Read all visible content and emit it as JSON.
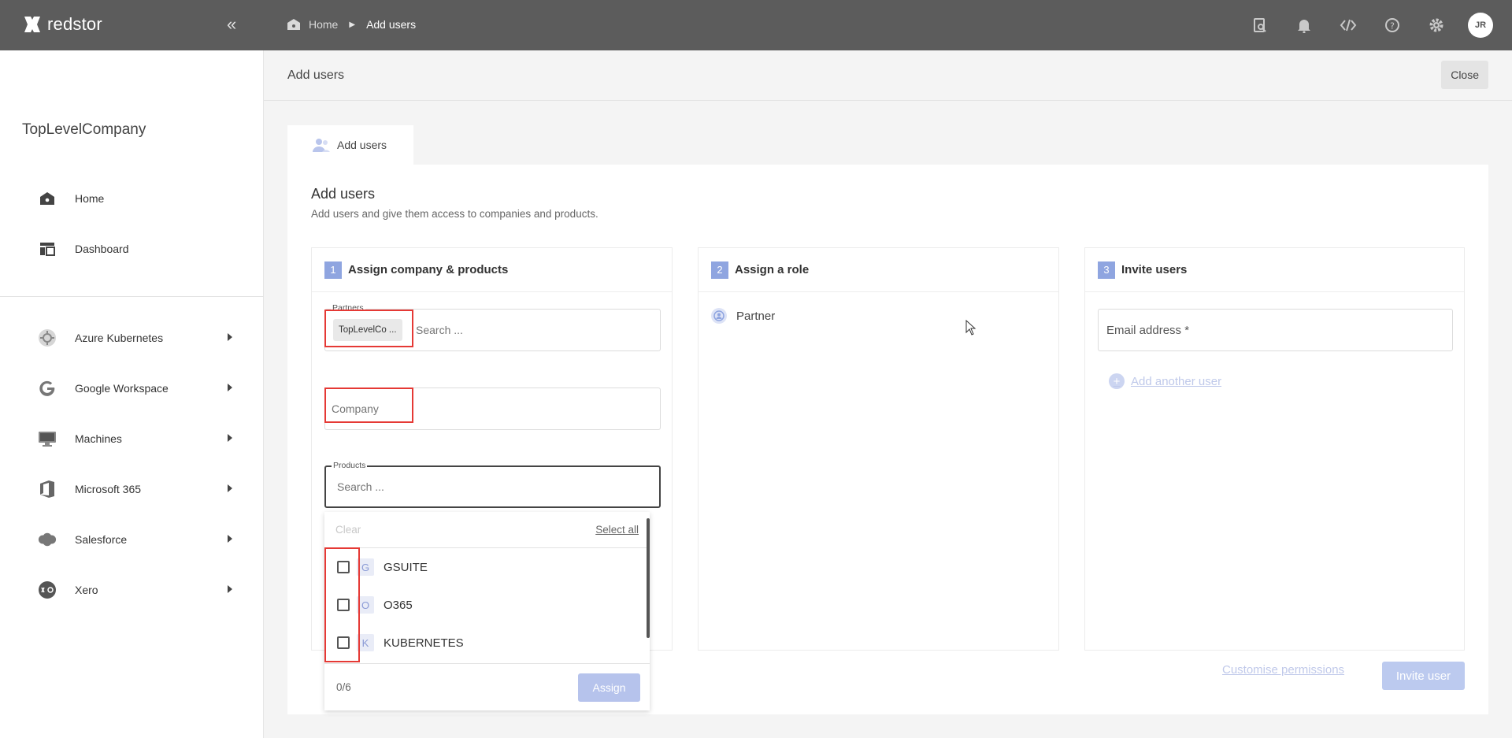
{
  "app": {
    "brand": "redstor"
  },
  "breadcrumb": {
    "home": "Home",
    "current": "Add users"
  },
  "sidebar": {
    "company": "TopLevelCompany",
    "top_items": [
      {
        "label": "Home",
        "icon": "home-icon"
      },
      {
        "label": "Dashboard",
        "icon": "dashboard-icon"
      }
    ],
    "product_items": [
      {
        "label": "Azure Kubernetes",
        "icon": "kubernetes-icon"
      },
      {
        "label": "Google Workspace",
        "icon": "google-icon"
      },
      {
        "label": "Machines",
        "icon": "monitor-icon"
      },
      {
        "label": "Microsoft 365",
        "icon": "office-icon"
      },
      {
        "label": "Salesforce",
        "icon": "salesforce-icon"
      },
      {
        "label": "Xero",
        "icon": "xero-icon"
      }
    ]
  },
  "user": {
    "initials": "JR"
  },
  "page": {
    "title": "Add users",
    "close_label": "Close",
    "tab_label": "Add users"
  },
  "card": {
    "title": "Add users",
    "subtitle": "Add users and give them access to companies and products."
  },
  "step1": {
    "number": "1",
    "title": "Assign company & products",
    "partners_label": "Partners",
    "partner_chip": "TopLevelCo ...",
    "partners_placeholder": "Search ...",
    "company_placeholder": "Company",
    "products_label": "Products",
    "products_placeholder": "Search ...",
    "clear_label": "Clear",
    "select_all_label": "Select all",
    "options": [
      {
        "letter": "G",
        "label": "GSUITE"
      },
      {
        "letter": "O",
        "label": "O365"
      },
      {
        "letter": "K",
        "label": "KUBERNETES"
      }
    ],
    "count": "0/6",
    "assign_label": "Assign"
  },
  "step2": {
    "number": "2",
    "title": "Assign a role",
    "role": "Partner"
  },
  "step3": {
    "number": "3",
    "title": "Invite users",
    "email_placeholder": "Email address *",
    "add_another_label": "Add another user",
    "customise_label": "Customise permissions",
    "invite_label": "Invite user"
  },
  "colors": {
    "topbar": "#5c5c5c",
    "accent": "#8fa5e0",
    "highlight": "#e53935"
  }
}
